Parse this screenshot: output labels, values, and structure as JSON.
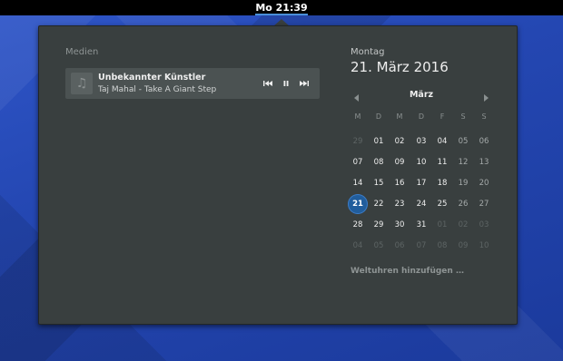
{
  "topbar": {
    "clock": "Mo 21:39"
  },
  "media": {
    "heading": "Medien",
    "artist": "Unbekannter Künstler",
    "title": "Taj Mahal - Take A Giant Step",
    "album_art_icon": "music-note-icon",
    "controls": [
      "previous-track-icon",
      "pause-icon",
      "next-track-icon"
    ]
  },
  "date": {
    "day_name": "Montag",
    "full_date": "21. März 2016"
  },
  "calendar": {
    "month": "März",
    "weekdays": [
      "M",
      "D",
      "M",
      "D",
      "F",
      "S",
      "S"
    ],
    "weeks": [
      [
        "29",
        "01",
        "02",
        "03",
        "04",
        "05",
        "06"
      ],
      [
        "07",
        "08",
        "09",
        "10",
        "11",
        "12",
        "13"
      ],
      [
        "14",
        "15",
        "16",
        "17",
        "18",
        "19",
        "20"
      ],
      [
        "21",
        "22",
        "23",
        "24",
        "25",
        "26",
        "27"
      ],
      [
        "28",
        "29",
        "30",
        "31",
        "01",
        "02",
        "03"
      ],
      [
        "04",
        "05",
        "06",
        "07",
        "08",
        "09",
        "10"
      ]
    ],
    "outside_month": [
      [
        true,
        false,
        false,
        false,
        false,
        false,
        false
      ],
      [
        false,
        false,
        false,
        false,
        false,
        false,
        false
      ],
      [
        false,
        false,
        false,
        false,
        false,
        false,
        false
      ],
      [
        false,
        false,
        false,
        false,
        false,
        false,
        false
      ],
      [
        false,
        false,
        false,
        false,
        true,
        true,
        true
      ],
      [
        true,
        true,
        true,
        true,
        true,
        true,
        true
      ]
    ],
    "today": "21"
  },
  "world_clocks": {
    "label": "Weltuhren hinzufügen …"
  },
  "colors": {
    "accent": "#215d9c",
    "topbar": "#000000",
    "popover": "#393f3f"
  }
}
